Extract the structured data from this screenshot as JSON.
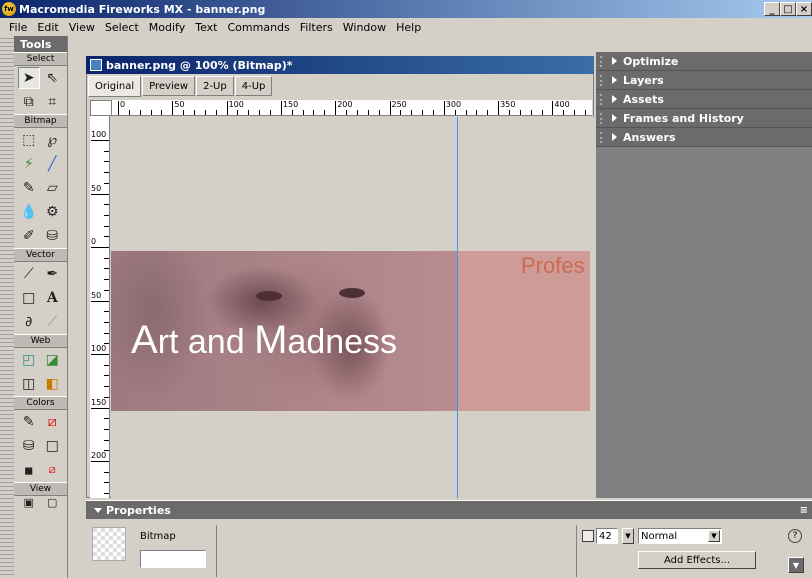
{
  "window": {
    "title": "Macromedia Fireworks MX - banner.png",
    "min": "_",
    "max": "□",
    "close": "×"
  },
  "menu": [
    "File",
    "Edit",
    "View",
    "Select",
    "Modify",
    "Text",
    "Commands",
    "Filters",
    "Window",
    "Help"
  ],
  "tools": {
    "title": "Tools",
    "sections": [
      "Select",
      "Bitmap",
      "Vector",
      "Web",
      "Colors",
      "View"
    ]
  },
  "document": {
    "title": "banner.png @ 100% (Bitmap)*",
    "tabs": [
      "Original",
      "Preview",
      "2-Up",
      "4-Up"
    ],
    "ruler_h": [
      "0",
      "50",
      "100",
      "150",
      "200",
      "250",
      "300",
      "350",
      "400"
    ],
    "ruler_v": [
      "100",
      "50",
      "0",
      "50",
      "100",
      "150",
      "200"
    ],
    "banner_title_a": "A",
    "banner_title_rest1": "rt and ",
    "banner_title_m": "M",
    "banner_title_rest2": "adness",
    "banner_prof": "Profes"
  },
  "panels": [
    "Optimize",
    "Layers",
    "Assets",
    "Frames and History",
    "Answers"
  ],
  "properties": {
    "title": "Properties",
    "type": "Bitmap",
    "opacity": "42",
    "blend": "Normal",
    "add_effects": "Add Effects...",
    "help": "?"
  }
}
